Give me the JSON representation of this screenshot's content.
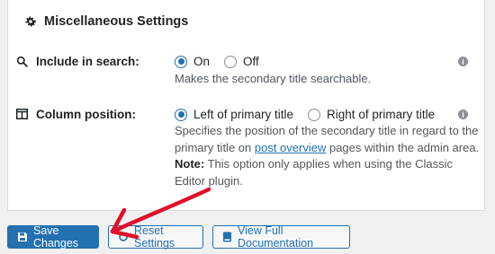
{
  "section": {
    "title": "Miscellaneous Settings",
    "title_icon": "gear-icon"
  },
  "include_in_search": {
    "label": "Include in search:",
    "icon": "search-icon",
    "options": [
      {
        "label": "On",
        "selected": true
      },
      {
        "label": "Off",
        "selected": false
      }
    ],
    "description": "Makes the secondary title searchable."
  },
  "column_position": {
    "label": "Column position:",
    "icon": "columns-icon",
    "options": [
      {
        "label": "Left of primary title",
        "selected": true
      },
      {
        "label": "Right of primary title",
        "selected": false
      }
    ],
    "description_before_link": "Specifies the position of the secondary title in regard to the primary title on ",
    "link_text": "post overview",
    "description_after_link": " pages within the admin area.",
    "note_label": "Note:",
    "note_text": " This option only applies when using the Classic Editor plugin."
  },
  "buttons": {
    "save_label": "Save Changes",
    "reset_label": "Reset Settings",
    "docs_label": "View Full Documentation"
  },
  "colors": {
    "accent": "#2271b1",
    "annotation": "#e0102a"
  }
}
